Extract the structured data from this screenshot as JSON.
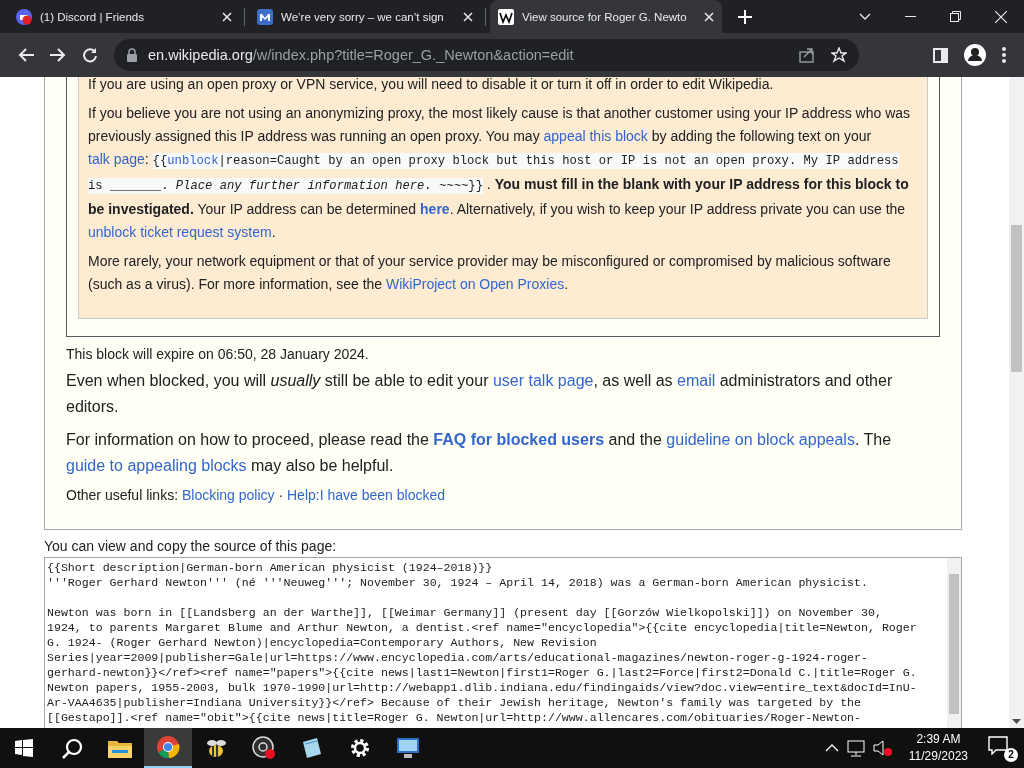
{
  "browser": {
    "tabs": [
      {
        "title": "(1) Discord | Friends",
        "selected": false,
        "kind": "circle"
      },
      {
        "title": "We’re very sorry – we can’t sign",
        "selected": false,
        "kind": "tile"
      },
      {
        "title": "View source for Roger G. Newto",
        "selected": true,
        "kind": "page"
      }
    ],
    "address": {
      "host": "en.wikipedia.org",
      "path": "/w/index.php?title=Roger_G._Newton&action=edit"
    }
  },
  "notice": {
    "paragraphs": [
      [
        {
          "kind": "text",
          "text": "If you are using an open proxy or VPN service, you will need to disable it or turn it off in order to edit Wikipedia."
        }
      ],
      [
        {
          "kind": "text",
          "text": "If you believe you are not using an anonymizing proxy, the most likely cause is that another customer using your IP address who was previously assigned this IP address was running an open proxy. You may "
        },
        {
          "kind": "link",
          "text": "appeal this block"
        },
        {
          "kind": "text",
          "text": " by adding the following text on your "
        },
        {
          "kind": "link",
          "text": "talk page"
        },
        {
          "kind": "text",
          "text": ": "
        },
        {
          "kind": "code",
          "text": "{{"
        },
        {
          "kind": "code_link",
          "text": "unblock"
        },
        {
          "kind": "code",
          "text": "|reason=Caught by an open proxy block but this host or IP is not an open proxy. My IP address"
        },
        {
          "kind": "code_start",
          "text": "is _______. "
        },
        {
          "kind": "code_italic",
          "text": "Place any further information here. ~~~~"
        },
        {
          "kind": "code",
          "text": "}}"
        },
        {
          "kind": "text",
          "text": " . "
        },
        {
          "kind": "bold",
          "text": "You must fill in the blank with your IP address for this block to be investigated."
        },
        {
          "kind": "text",
          "text": " Your IP address can be determined "
        },
        {
          "kind": "bold_link",
          "text": "here"
        },
        {
          "kind": "text",
          "text": ". Alternatively, if you wish to keep your IP address private you can use the "
        },
        {
          "kind": "link",
          "text": "unblock ticket request system"
        },
        {
          "kind": "text",
          "text": "."
        }
      ],
      [
        {
          "kind": "text",
          "text": "More rarely, your network equipment or that of your service provider may be misconfigured or compromised by malicious software (such as a virus). For more information, see the "
        },
        {
          "kind": "link",
          "text": "WikiProject on Open Proxies"
        },
        {
          "kind": "text",
          "text": "."
        }
      ]
    ]
  },
  "expiry": "This block will expire on 06:50, 28 January 2024.",
  "paragraphs": [
    [
      {
        "kind": "text",
        "text": "Even when blocked, you will "
      },
      {
        "kind": "italic",
        "text": "usually"
      },
      {
        "kind": "text",
        "text": " still be able to edit your "
      },
      {
        "kind": "link",
        "text": "user talk page"
      },
      {
        "kind": "text",
        "text": ", as well as "
      },
      {
        "kind": "link",
        "text": "email"
      },
      {
        "kind": "text",
        "text": " administrators and other editors."
      }
    ],
    [
      {
        "kind": "text",
        "text": "For information on how to proceed, please read the "
      },
      {
        "kind": "bold_link",
        "text": "FAQ for blocked users"
      },
      {
        "kind": "text",
        "text": " and the "
      },
      {
        "kind": "link",
        "text": "guideline on block appeals"
      },
      {
        "kind": "text",
        "text": ". The "
      },
      {
        "kind": "link",
        "text": "guide to appealing blocks"
      },
      {
        "kind": "text",
        "text": " may also be helpful."
      }
    ]
  ],
  "useful_links": [
    {
      "kind": "text",
      "text": "Other useful links: "
    },
    {
      "kind": "link",
      "text": "Blocking policy"
    },
    {
      "kind": "text",
      "text": " · "
    },
    {
      "kind": "link",
      "text": "Help:I have been blocked"
    }
  ],
  "source_label": "You can view and copy the source of this page:",
  "source_text": "{{Short description|German-born American physicist (1924–2018)}}\n'''Roger Gerhard Newton''' (né '''Neuweg'''; November 30, 1924 – April 14, 2018) was a German-born American physicist.\n\nNewton was born in [[Landsberg an der Warthe]], [[Weimar Germany]] (present day [[Gorzów Wielkopolski]]) on November 30,\n1924, to parents Margaret Blume and Arthur Newton, a dentist.<ref name=\"encyclopedia\">{{cite encyclopedia|title=Newton, Roger\nG. 1924- (Roger Gerhard Newton)|encyclopedia=Contemporary Authors, New Revision\nSeries|year=2009|publisher=Gale|url=https://www.encyclopedia.com/arts/educational-magazines/newton-roger-g-1924-roger-\ngerhard-newton}}</ref><ref name=\"papers\">{{cite news|last1=Newton|first1=Roger G.|last2=Force|first2=Donald C.|title=Roger G.\nNewton papers, 1955-2003, bulk 1970-1990|url=http://webapp1.dlib.indiana.edu/findingaids/view?doc.view=entire_text&docId=InU-\nAr-VAA4635|publisher=Indiana University}}</ref> Because of their Jewish heritage, Newton's family was targeted by the\n[[Gestapo]].<ref name=\"obit\">{{cite news|title=Roger G. Newton|url=http://www.allencares.com/obituaries/Roger-Newton-",
  "taskbar": {
    "apps": [
      {
        "kind": "search",
        "selected": false
      },
      {
        "kind": "folder",
        "selected": false
      },
      {
        "kind": "browser",
        "selected": true
      },
      {
        "kind": "bee",
        "selected": false
      },
      {
        "kind": "recorder",
        "selected": false
      },
      {
        "kind": "notepad",
        "selected": false
      },
      {
        "kind": "settings",
        "selected": false
      },
      {
        "kind": "remote",
        "selected": false
      }
    ],
    "time": "2:39 AM",
    "date": "11/29/2023",
    "notifications": "2"
  }
}
